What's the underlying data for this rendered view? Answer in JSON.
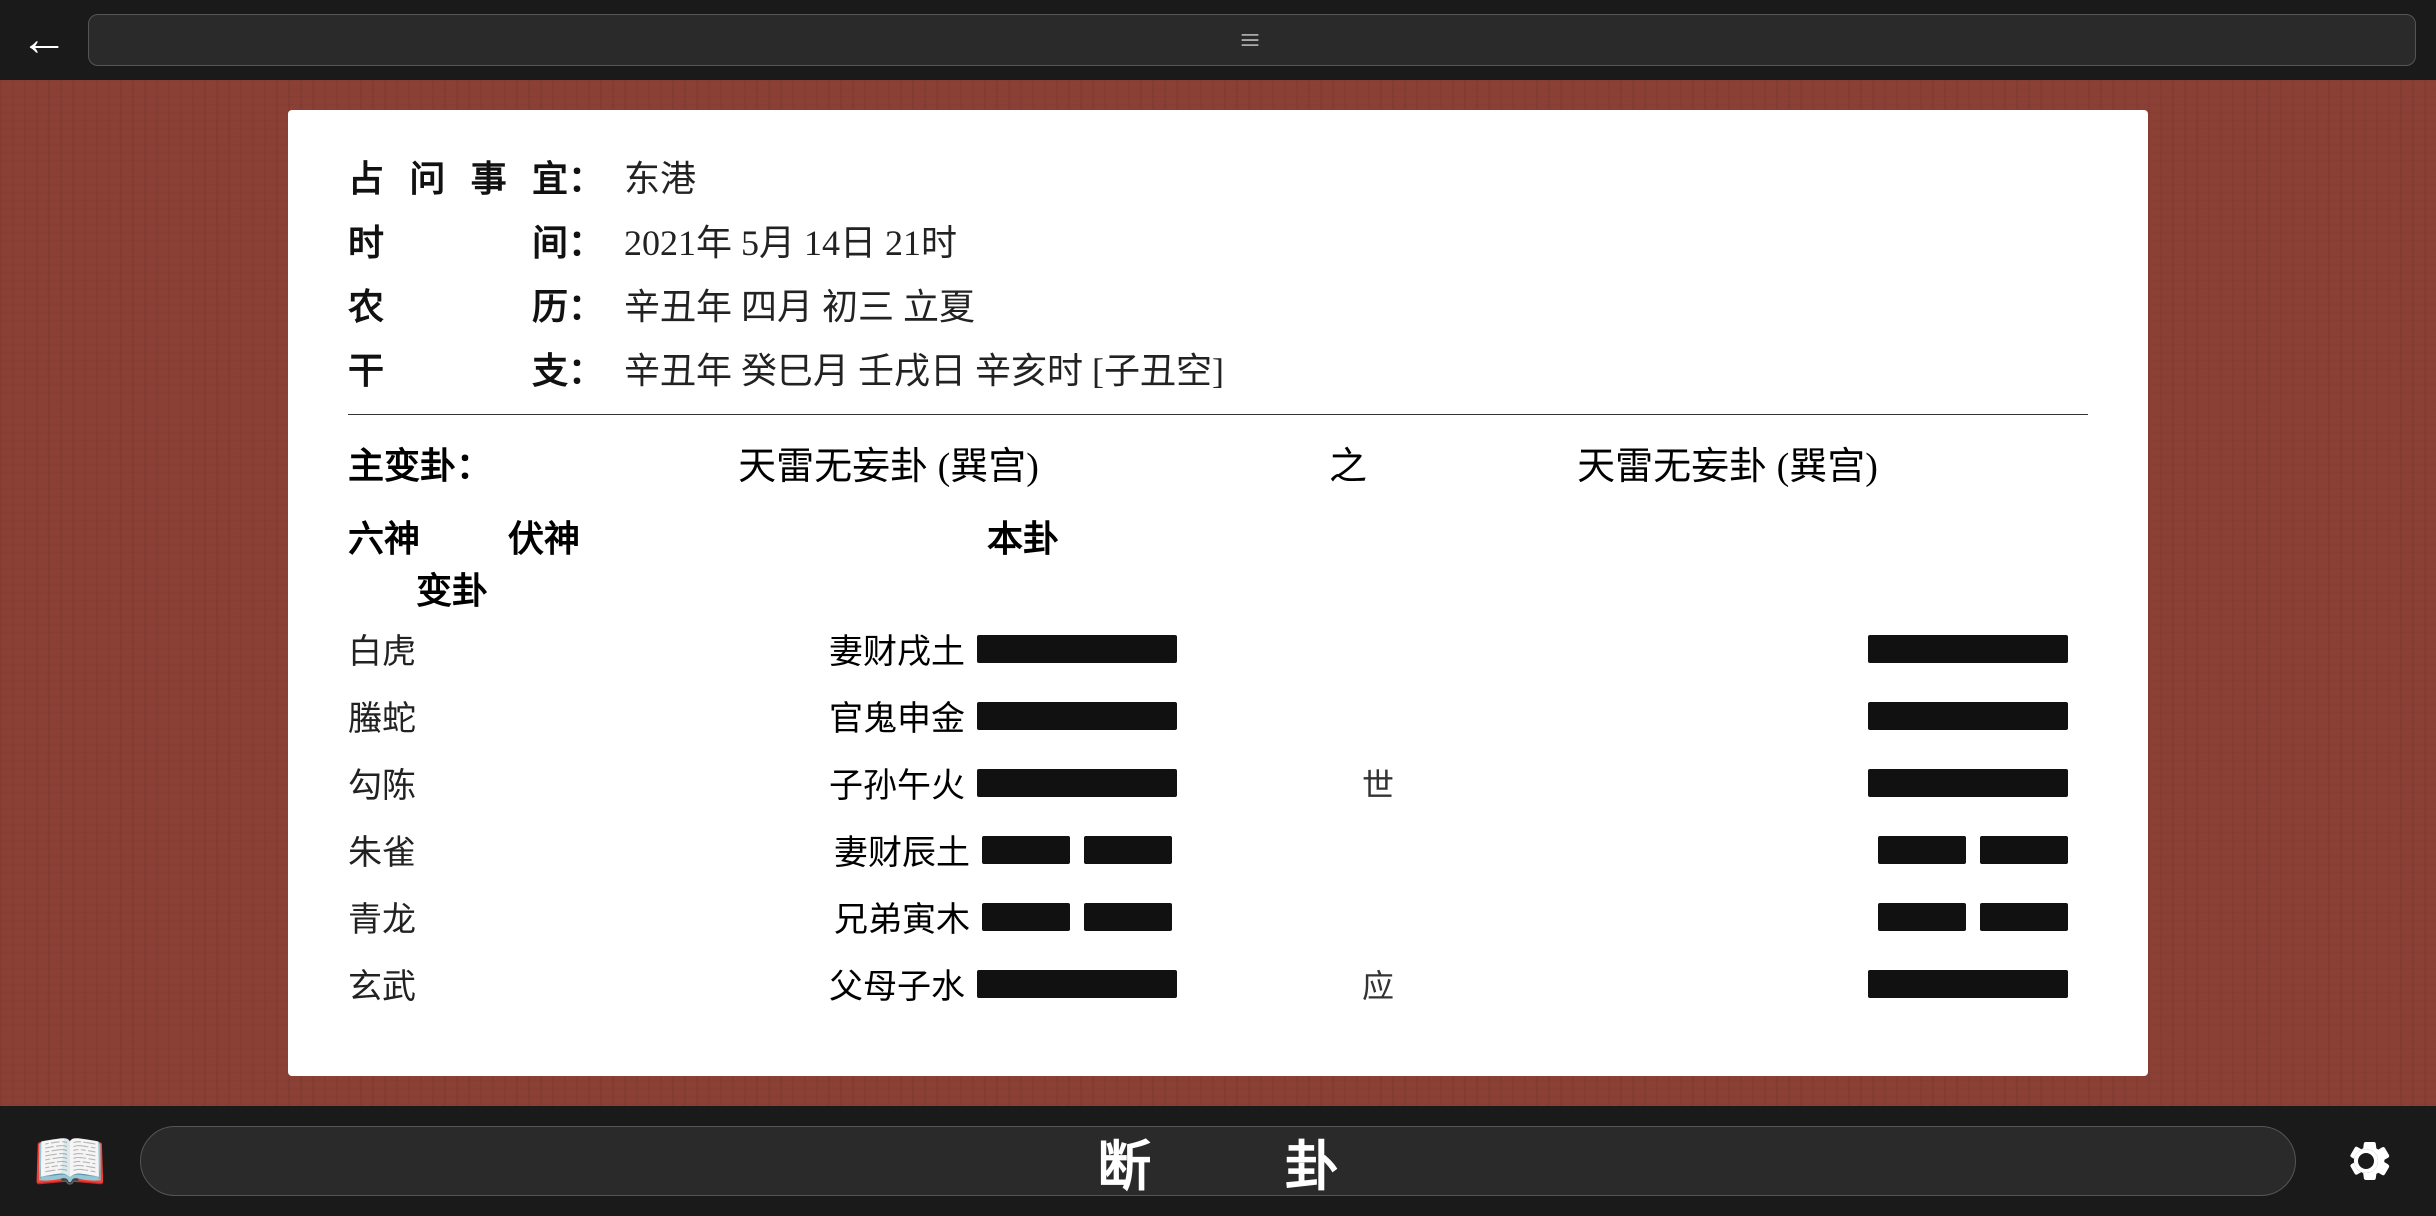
{
  "topBar": {
    "backLabel": "←",
    "hamburger": "≡"
  },
  "card": {
    "info": {
      "rows": [
        {
          "label": "占问事宜：",
          "value": "东港"
        },
        {
          "label": "时    间：",
          "value": "2021年 5月 14日 21时"
        },
        {
          "label": "农    历：",
          "value": "辛丑年 四月 初三 立夏"
        },
        {
          "label": "干    支：",
          "value": "辛丑年 癸巳月 壬戌日 辛亥时 [子丑空]"
        }
      ]
    },
    "hexagram": {
      "mainLabel": "主变卦：",
      "mainTitle": "天雷无妄卦 (巽宫)",
      "zhi": "之",
      "varTitle": "天雷无妄卦 (巽宫)",
      "colHeaders": {
        "liushen": "六神",
        "fushen": "伏神",
        "bengua": "本卦",
        "biangua": "变卦"
      },
      "rows": [
        {
          "liushen": "白虎",
          "fushen": "",
          "yaoName": "妻财戌土",
          "yaoType": "solid",
          "mark": "",
          "bianType": "solid"
        },
        {
          "liushen": "螣蛇",
          "fushen": "",
          "yaoName": "官鬼申金",
          "yaoType": "solid",
          "mark": "",
          "bianType": "solid"
        },
        {
          "liushen": "勾陈",
          "fushen": "",
          "yaoName": "子孙午火",
          "yaoType": "solid",
          "mark": "世",
          "bianType": "solid"
        },
        {
          "liushen": "朱雀",
          "fushen": "",
          "yaoName": "妻财辰土",
          "yaoType": "broken",
          "mark": "",
          "bianType": "broken"
        },
        {
          "liushen": "青龙",
          "fushen": "",
          "yaoName": "兄弟寅木",
          "yaoType": "broken",
          "mark": "",
          "bianType": "broken"
        },
        {
          "liushen": "玄武",
          "fushen": "",
          "yaoName": "父母子水",
          "yaoType": "solid",
          "mark": "应",
          "bianType": "solid"
        }
      ]
    }
  },
  "bottomBar": {
    "centerText": "断    卦",
    "bookIcon": "📖",
    "gearIcon": "⚙"
  }
}
